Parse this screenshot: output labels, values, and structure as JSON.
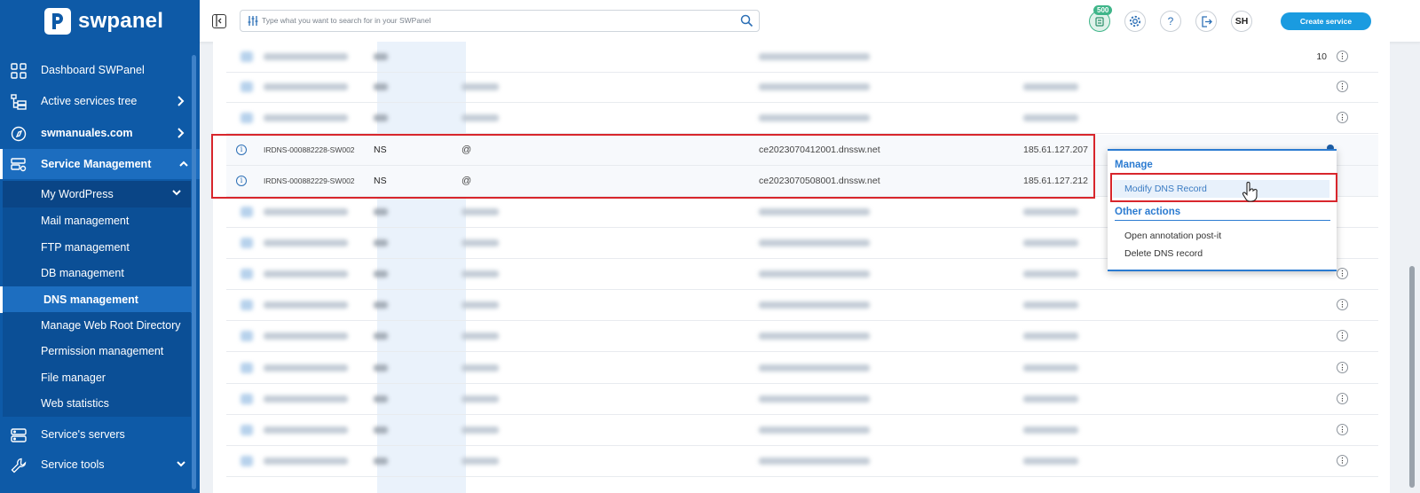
{
  "app": {
    "name": "swpanel"
  },
  "sidebar": {
    "items": [
      {
        "label": "Dashboard SWPanel",
        "icon": "dashboard-grid-icon"
      },
      {
        "label": "Active services tree",
        "icon": "tree-icon"
      },
      {
        "label": "swmanuales.com",
        "icon": "compass-icon"
      },
      {
        "label": "Service Management",
        "icon": "server-settings-icon"
      }
    ],
    "submenu_head": "My WordPress",
    "submenu": [
      "Mail management",
      "FTP management",
      "DB management",
      "DNS management",
      "Manage Web Root Directory",
      "Permission management",
      "File manager",
      "Web statistics"
    ],
    "bottom_items": [
      {
        "label": "Service's servers",
        "icon": "server-icon"
      },
      {
        "label": "Service tools",
        "icon": "wrench-icon"
      }
    ]
  },
  "topbar": {
    "search_placeholder": "Type what you want to search for in your SWPanel",
    "cart_badge": "500",
    "help_label": "?",
    "user_initials": "SH",
    "create_button": "Create service"
  },
  "table": {
    "first_row_count": "10",
    "highlighted_rows": [
      {
        "id": "IRDNS-000882228-SW002",
        "type": "NS",
        "name": "@",
        "value": "ce2023070412001.dnssw.net",
        "ip": "185.61.127.207"
      },
      {
        "id": "IRDNS-000882229-SW002",
        "type": "NS",
        "name": "@",
        "value": "ce2023070508001.dnssw.net",
        "ip": "185.61.127.212"
      }
    ]
  },
  "dropdown": {
    "manage_title": "Manage",
    "modify_item": "Modify DNS Record",
    "other_title": "Other actions",
    "other_items": [
      "Open annotation post-it",
      "Delete DNS record"
    ]
  }
}
